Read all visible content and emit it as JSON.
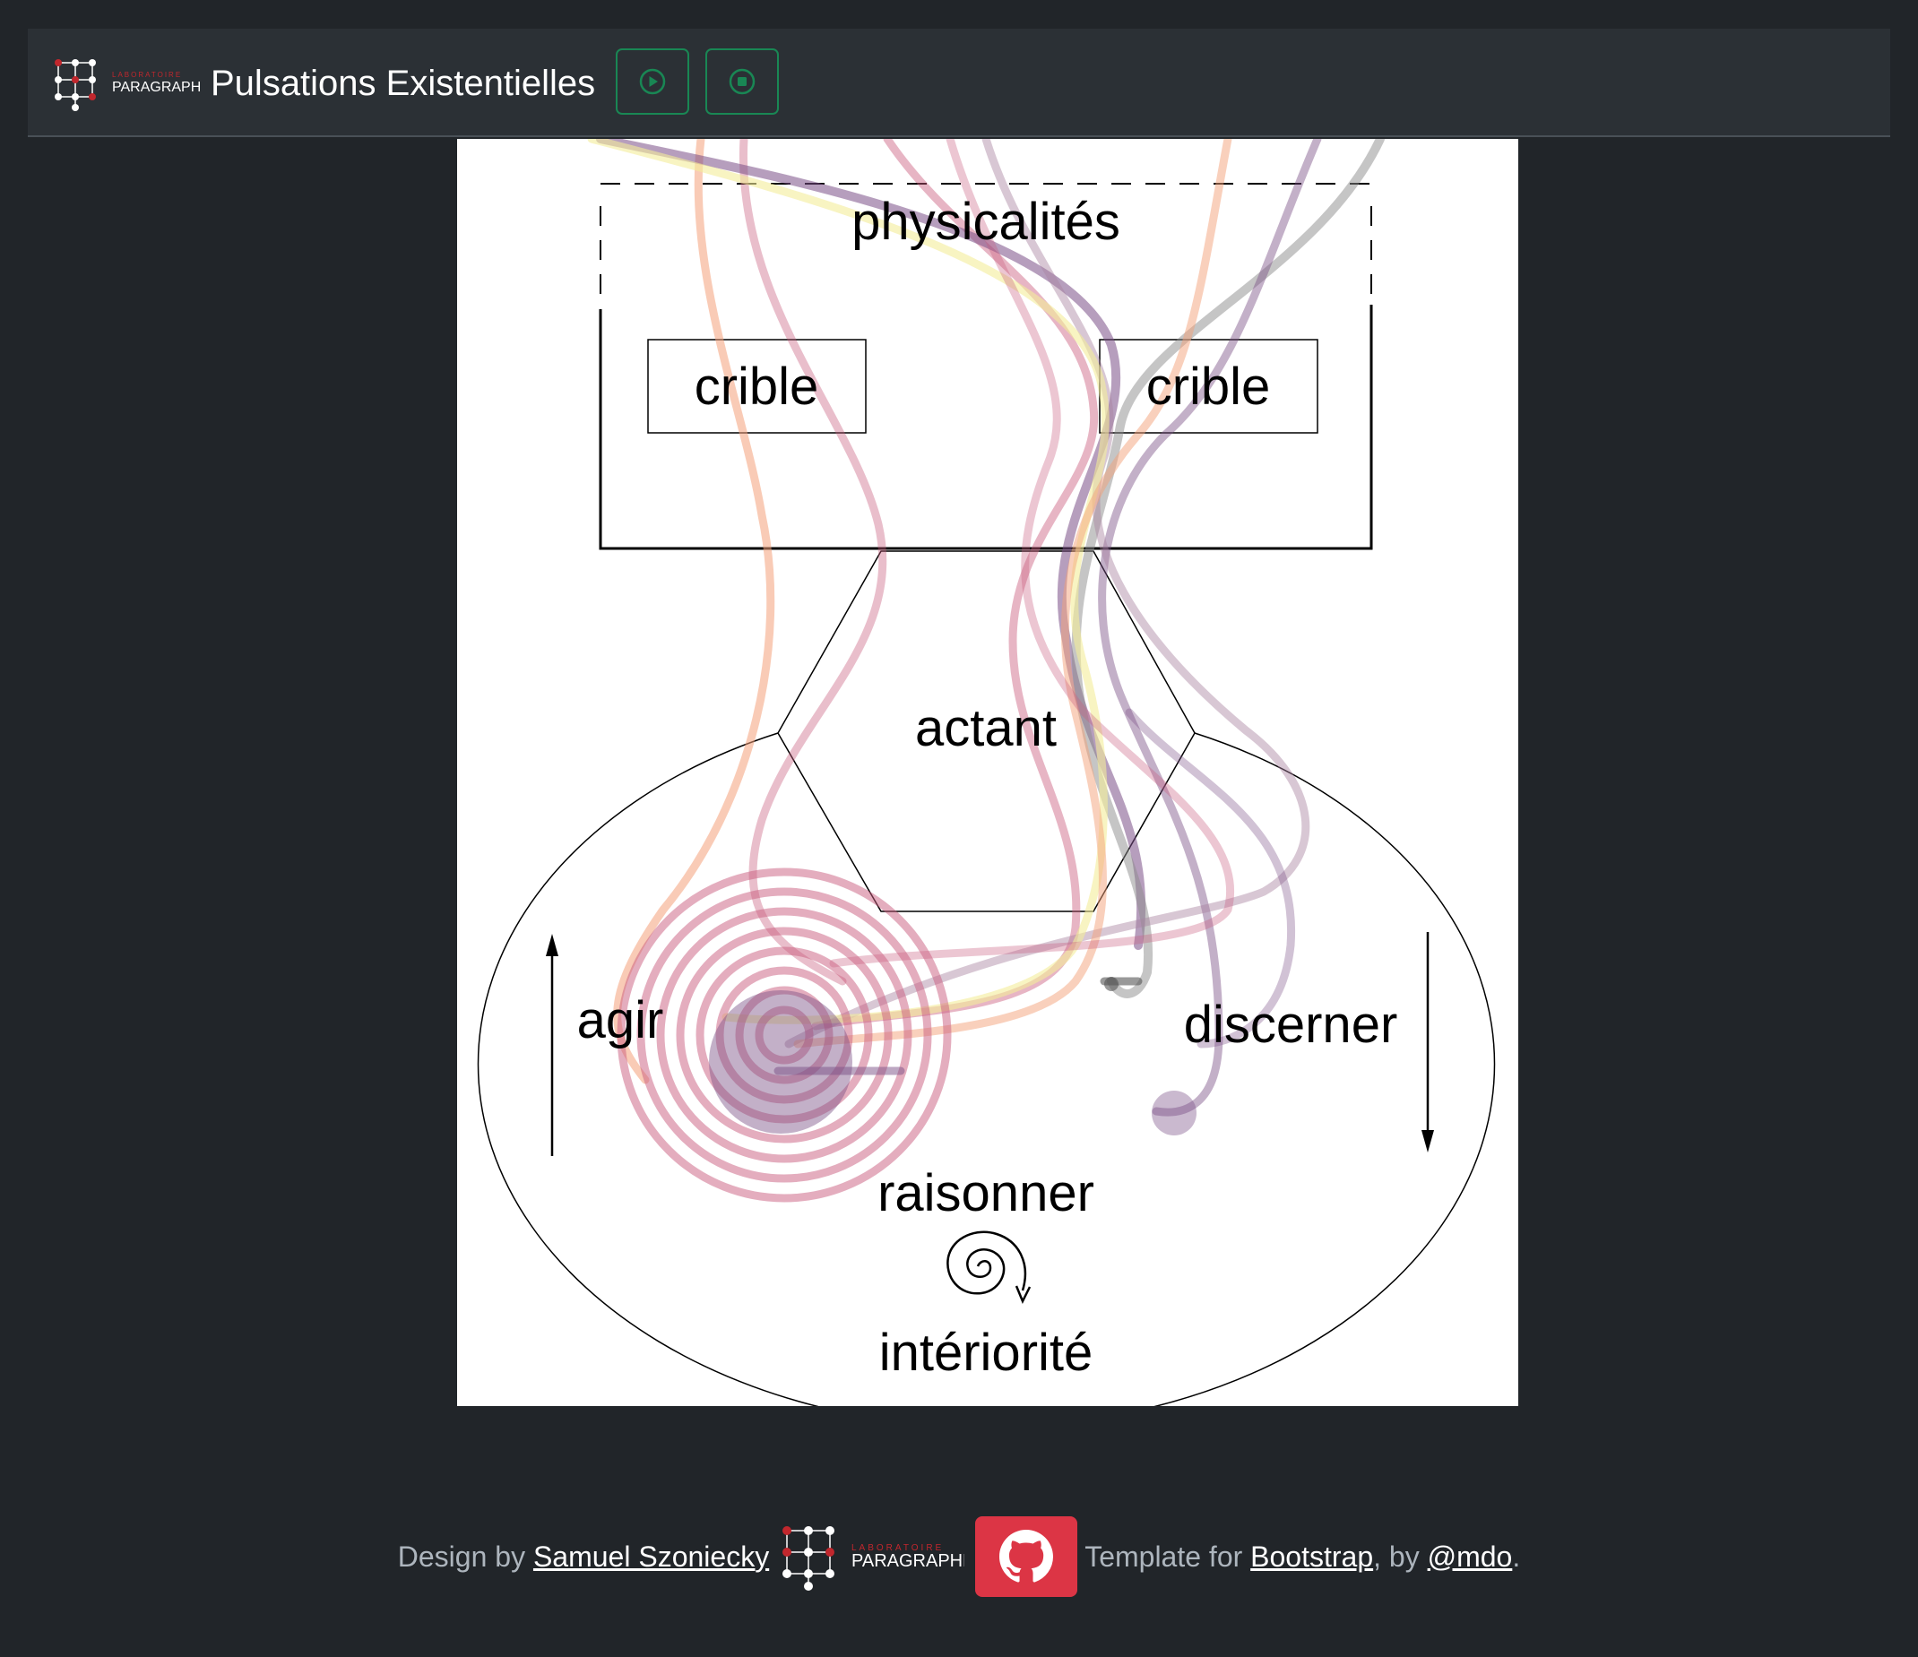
{
  "header": {
    "logo": {
      "top_text": "LABORATOIRE",
      "main_text": "PARAGRAPHE"
    },
    "title": "Pulsations Existentielles",
    "buttons": [
      {
        "name": "play",
        "icon": "play-circle-icon"
      },
      {
        "name": "stop",
        "icon": "stop-circle-icon"
      }
    ]
  },
  "diagram": {
    "labels": {
      "physicalites": "physicalités",
      "crible_left": "crible",
      "crible_right": "crible",
      "actant": "actant",
      "agir": "agir",
      "discerner": "discerner",
      "raisonner": "raisonner",
      "interiorite": "intériorité"
    },
    "trail_colors": [
      "#c95c7d",
      "#f4a17a",
      "#7a4f86",
      "#8c8c8c",
      "#f3ec9a",
      "#a8839f"
    ]
  },
  "footer": {
    "design_by": "Design by",
    "author": "Samuel Szoniecky",
    "logo": {
      "top_text": "LABORATOIRE",
      "main_text": "PARAGRAPHE"
    },
    "github_icon": "github-icon",
    "template_for": "Template for",
    "bootstrap": "Bootstrap",
    "by": ", by",
    "mdo": "@mdo",
    "end": "."
  }
}
